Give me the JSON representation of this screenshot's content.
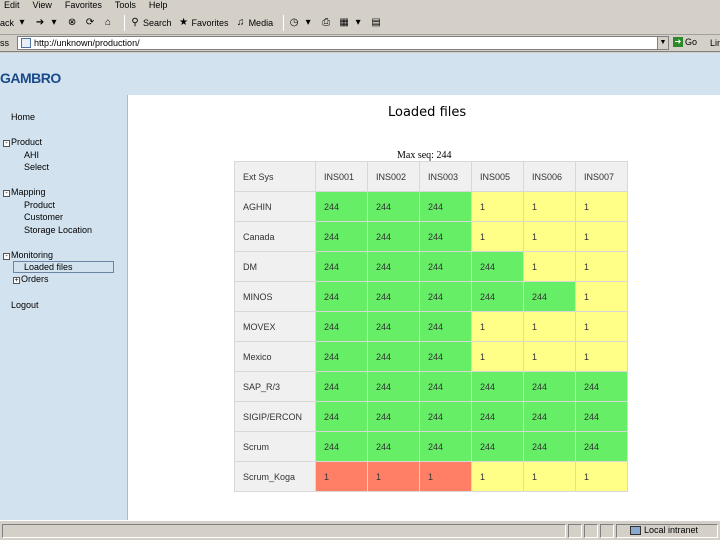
{
  "menu": [
    "Edit",
    "View",
    "Favorites",
    "Tools",
    "Help"
  ],
  "toolbar": {
    "back_label": "ack",
    "search_label": "Search",
    "favorites_label": "Favorites",
    "media_label": "Media"
  },
  "address": {
    "label": "ss",
    "url": "http://unknown/production/",
    "go_label": "Go",
    "links_label": "Lin"
  },
  "logo": "GAMBRO",
  "nav": {
    "home": "Home",
    "product": "Product",
    "product_box": "-",
    "product_ahi": "AHI",
    "product_select": "Select",
    "mapping": "Mapping",
    "mapping_box": "-",
    "mapping_product": "Product",
    "mapping_customer": "Customer",
    "mapping_storage": "Storage Location",
    "monitoring": "Monitoring",
    "monitoring_box": "-",
    "loaded_files": "Loaded files",
    "orders": "Orders",
    "orders_box": "+",
    "logout": "Logout"
  },
  "page": {
    "title": "Loaded files",
    "subtitle": "Max seq: 244"
  },
  "table": {
    "header": [
      "Ext Sys",
      "INS001",
      "INS002",
      "INS003",
      "INS005",
      "INS006",
      "INS007"
    ],
    "rows": [
      {
        "name": "AGHIN",
        "cells": [
          [
            "244",
            "ok"
          ],
          [
            "244",
            "ok"
          ],
          [
            "244",
            "ok"
          ],
          [
            "1",
            "warn"
          ],
          [
            "1",
            "warn"
          ],
          [
            "1",
            "warn"
          ]
        ]
      },
      {
        "name": "Canada",
        "cells": [
          [
            "244",
            "ok"
          ],
          [
            "244",
            "ok"
          ],
          [
            "244",
            "ok"
          ],
          [
            "1",
            "warn"
          ],
          [
            "1",
            "warn"
          ],
          [
            "1",
            "warn"
          ]
        ]
      },
      {
        "name": "DM",
        "cells": [
          [
            "244",
            "ok"
          ],
          [
            "244",
            "ok"
          ],
          [
            "244",
            "ok"
          ],
          [
            "244",
            "ok"
          ],
          [
            "1",
            "warn"
          ],
          [
            "1",
            "warn"
          ]
        ]
      },
      {
        "name": "MINOS",
        "cells": [
          [
            "244",
            "ok"
          ],
          [
            "244",
            "ok"
          ],
          [
            "244",
            "ok"
          ],
          [
            "244",
            "ok"
          ],
          [
            "244",
            "ok"
          ],
          [
            "1",
            "warn"
          ]
        ]
      },
      {
        "name": "MOVEX",
        "cells": [
          [
            "244",
            "ok"
          ],
          [
            "244",
            "ok"
          ],
          [
            "244",
            "ok"
          ],
          [
            "1",
            "warn"
          ],
          [
            "1",
            "warn"
          ],
          [
            "1",
            "warn"
          ]
        ]
      },
      {
        "name": "Mexico",
        "cells": [
          [
            "244",
            "ok"
          ],
          [
            "244",
            "ok"
          ],
          [
            "244",
            "ok"
          ],
          [
            "1",
            "warn"
          ],
          [
            "1",
            "warn"
          ],
          [
            "1",
            "warn"
          ]
        ]
      },
      {
        "name": "SAP_R/3",
        "cells": [
          [
            "244",
            "ok"
          ],
          [
            "244",
            "ok"
          ],
          [
            "244",
            "ok"
          ],
          [
            "244",
            "ok"
          ],
          [
            "244",
            "ok"
          ],
          [
            "244",
            "ok"
          ]
        ]
      },
      {
        "name": "SIGIP/ERCON",
        "cells": [
          [
            "244",
            "ok"
          ],
          [
            "244",
            "ok"
          ],
          [
            "244",
            "ok"
          ],
          [
            "244",
            "ok"
          ],
          [
            "244",
            "ok"
          ],
          [
            "244",
            "ok"
          ]
        ]
      },
      {
        "name": "Scrum",
        "cells": [
          [
            "244",
            "ok"
          ],
          [
            "244",
            "ok"
          ],
          [
            "244",
            "ok"
          ],
          [
            "244",
            "ok"
          ],
          [
            "244",
            "ok"
          ],
          [
            "244",
            "ok"
          ]
        ]
      },
      {
        "name": "Scrum_Koga",
        "cells": [
          [
            "1",
            "err"
          ],
          [
            "1",
            "err"
          ],
          [
            "1",
            "err"
          ],
          [
            "1",
            "warn"
          ],
          [
            "1",
            "warn"
          ],
          [
            "1",
            "warn"
          ]
        ]
      }
    ]
  },
  "colors": {
    "ok": "#66ee66",
    "warn": "#ffff88",
    "err": "#ff7f66",
    "header_band": "#d2e2ee",
    "brand": "#1a4a8a"
  },
  "status": {
    "zone": "Local intranet"
  }
}
